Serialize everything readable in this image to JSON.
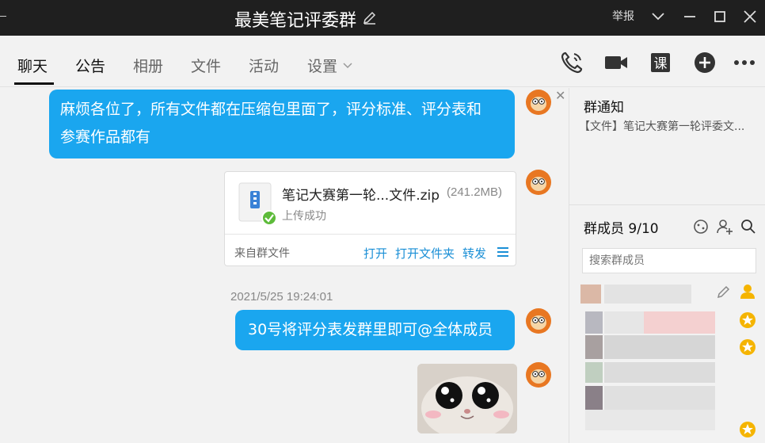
{
  "window": {
    "title": "最美笔记评委群",
    "report_label": "举报"
  },
  "tabs": [
    {
      "label": "聊天"
    },
    {
      "label": "公告"
    },
    {
      "label": "相册"
    },
    {
      "label": "文件"
    },
    {
      "label": "活动"
    },
    {
      "label": "设置"
    }
  ],
  "toolbar_icons": [
    "phone-icon",
    "video-icon",
    "lesson-icon",
    "add-icon",
    "more-icon"
  ],
  "messages": {
    "msg1_line1": "麻烦各位了，所有文件都在压缩包里面了，评分标准、评分表和",
    "msg1_line2": "参赛作品都有",
    "file": {
      "name": "笔记大赛第一轮...文件.zip",
      "size": "(241.2MB)",
      "status": "上传成功",
      "source": "来自群文件",
      "actions": [
        "打开",
        "打开文件夹",
        "转发"
      ]
    },
    "timestamp": "2021/5/25 19:24:01",
    "msg2": "30号将评分表发群里即可@全体成员"
  },
  "right_panel": {
    "notice_title": "群通知",
    "notice_text": "【文件】笔记大赛第一轮评委文...",
    "members_title": "群成员 9/10",
    "search_placeholder": "搜索群成员"
  },
  "colors": {
    "bubble": "#1aa6ef",
    "titlebar": "#1f1f1f",
    "link": "#1a8fd6",
    "star": "#f5b400"
  }
}
